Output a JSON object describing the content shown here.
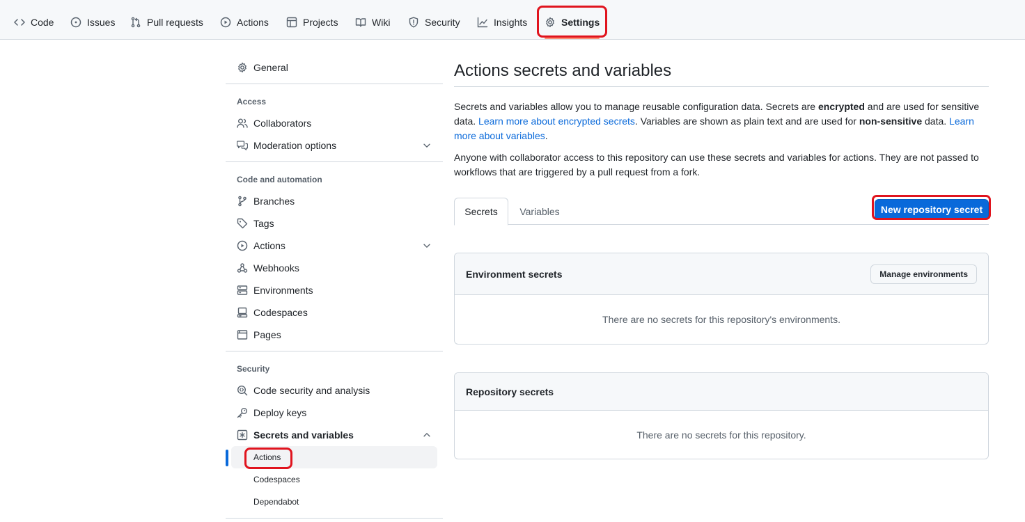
{
  "topnav": {
    "tabs": [
      {
        "label": "Code",
        "icon": "code-icon"
      },
      {
        "label": "Issues",
        "icon": "issue-opened-icon"
      },
      {
        "label": "Pull requests",
        "icon": "git-pull-request-icon"
      },
      {
        "label": "Actions",
        "icon": "play-icon"
      },
      {
        "label": "Projects",
        "icon": "table-icon"
      },
      {
        "label": "Wiki",
        "icon": "book-icon"
      },
      {
        "label": "Security",
        "icon": "shield-icon"
      },
      {
        "label": "Insights",
        "icon": "graph-icon"
      },
      {
        "label": "Settings",
        "icon": "gear-icon",
        "active": true
      }
    ]
  },
  "sidebar": {
    "general": "General",
    "access_heading": "Access",
    "collaborators": "Collaborators",
    "moderation": "Moderation options",
    "code_heading": "Code and automation",
    "branches": "Branches",
    "tags": "Tags",
    "actions": "Actions",
    "webhooks": "Webhooks",
    "environments": "Environments",
    "codespaces": "Codespaces",
    "pages": "Pages",
    "security_heading": "Security",
    "code_security": "Code security and analysis",
    "deploy_keys": "Deploy keys",
    "secrets": "Secrets and variables",
    "secrets_sub": {
      "actions": "Actions",
      "codespaces": "Codespaces",
      "dependabot": "Dependabot"
    }
  },
  "main": {
    "title": "Actions secrets and variables",
    "intro": {
      "t1": "Secrets and variables allow you to manage reusable configuration data. Secrets are ",
      "b1": "encrypted",
      "t2": " and are used for sensitive data. ",
      "link1": "Learn more about encrypted secrets",
      "t3": ". Variables are shown as plain text and are used for ",
      "b2": "non-sensitive",
      "t4": " data. ",
      "link2": "Learn more about variables",
      "t5": "."
    },
    "note": "Anyone with collaborator access to this repository can use these secrets and variables for actions. They are not passed to workflows that are triggered by a pull request from a fork.",
    "tabs": {
      "secrets": "Secrets",
      "variables": "Variables"
    },
    "new_secret_button": "New repository secret",
    "environment_box": {
      "title": "Environment secrets",
      "button": "Manage environments",
      "empty": "There are no secrets for this repository's environments."
    },
    "repository_box": {
      "title": "Repository secrets",
      "empty": "There are no secrets for this repository."
    }
  },
  "colors": {
    "primary": "#0969da",
    "annotation": "#e0141e",
    "active_tab_underline": "#fd8c73"
  }
}
